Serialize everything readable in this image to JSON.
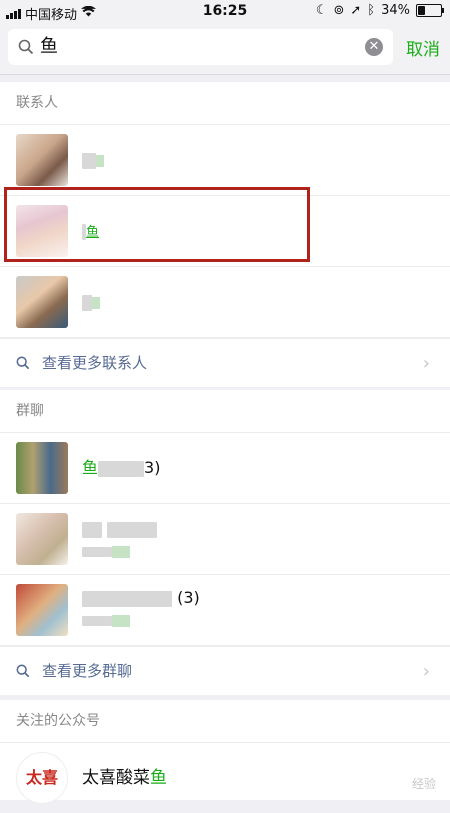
{
  "status_bar": {
    "carrier": "中国移动",
    "time": "16:25",
    "battery": "34%",
    "battery_level": 0.34
  },
  "search": {
    "query": "鱼",
    "cancel_label": "取消"
  },
  "contacts": {
    "title": "联系人",
    "rows": [
      {
        "name_hl": ""
      },
      {
        "name_hl": "鱼"
      },
      {
        "name_hl": ""
      }
    ],
    "more_label": "查看更多联系人"
  },
  "groups": {
    "title": "群聊",
    "rows": [
      {
        "name_hl": "鱼",
        "suffix": "3)"
      },
      {
        "suffix": ""
      },
      {
        "suffix": "(3)"
      }
    ],
    "more_label": "查看更多群聊"
  },
  "official": {
    "title": "关注的公众号",
    "rows": [
      {
        "logo": "太喜",
        "name": "太喜酸菜",
        "name_hl": "鱼"
      }
    ]
  },
  "watermark": "经验"
}
